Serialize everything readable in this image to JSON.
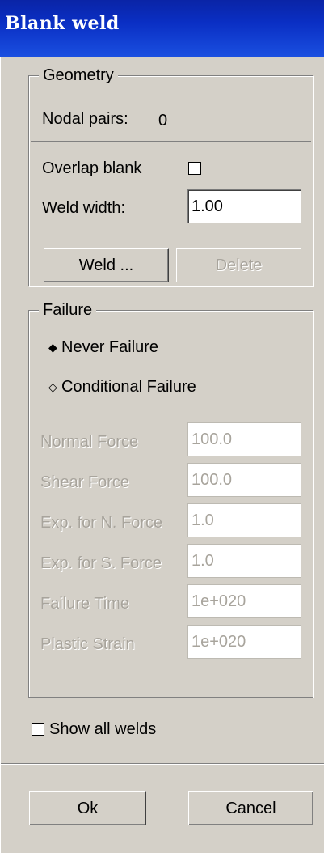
{
  "window": {
    "title": "Blank weld"
  },
  "geometry": {
    "legend": "Geometry",
    "nodal_pairs_label": "Nodal pairs:",
    "nodal_pairs_value": "0",
    "overlap_blank_label": "Overlap blank",
    "overlap_blank_checked": false,
    "weld_width_label": "Weld width:",
    "weld_width_value": "1.00",
    "weld_button": "Weld ...",
    "delete_button": "Delete"
  },
  "failure": {
    "legend": "Failure",
    "never_failure_label": "Never Failure",
    "never_failure_selected": true,
    "conditional_failure_label": "Conditional Failure",
    "conditional_failure_selected": false,
    "fields": [
      {
        "label": "Normal Force",
        "value": "100.0"
      },
      {
        "label": "Shear Force",
        "value": "100.0"
      },
      {
        "label": "Exp. for N. Force",
        "value": "1.0"
      },
      {
        "label": "Exp. for S. Force",
        "value": "1.0"
      },
      {
        "label": "Failure Time",
        "value": "1e+020"
      },
      {
        "label": "Plastic Strain",
        "value": "1e+020"
      }
    ]
  },
  "show_all_welds": {
    "label": "Show all welds",
    "checked": false
  },
  "footer": {
    "ok_label": "Ok",
    "cancel_label": "Cancel"
  }
}
